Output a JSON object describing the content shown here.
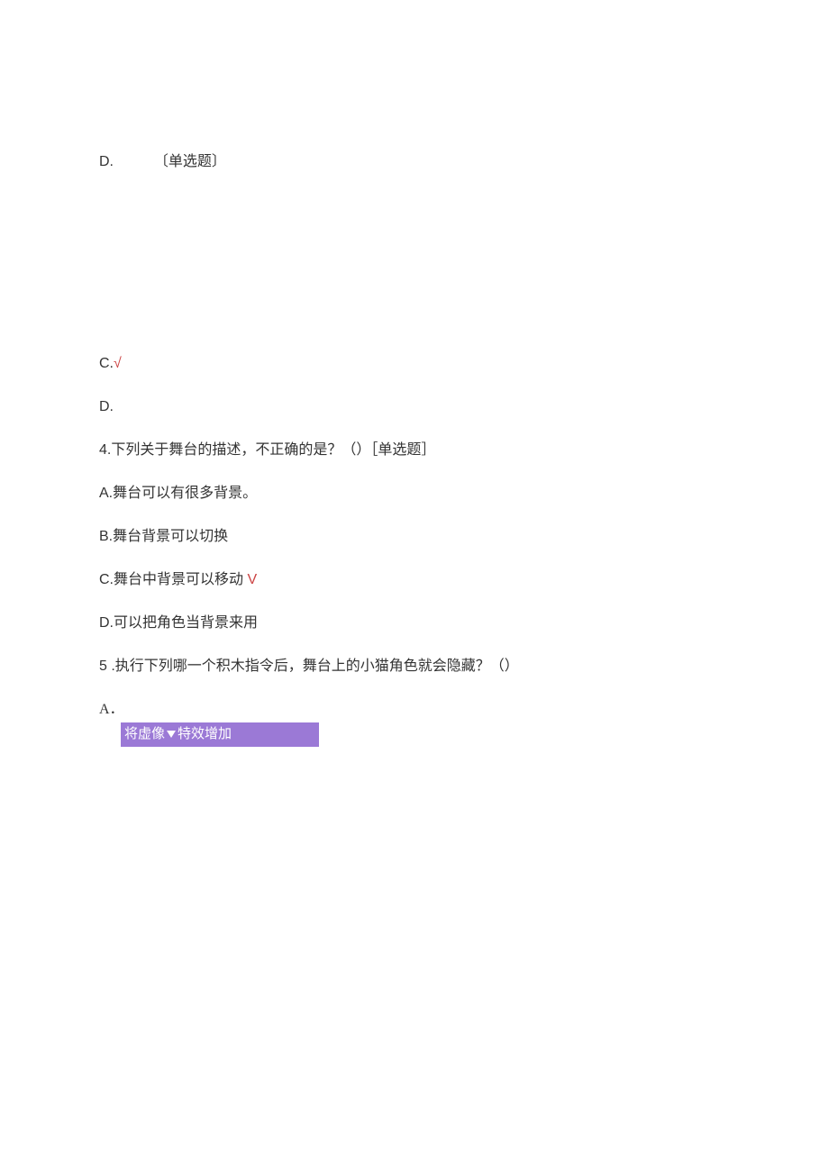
{
  "q_prev": {
    "option_d_label": "D.",
    "tag": "〔单选题〕"
  },
  "q3_tail": {
    "option_c_label": "C.",
    "option_c_mark": "√",
    "option_d_label": "D."
  },
  "q4": {
    "stem": "4.下列关于舞台的描述，不正确的是？（）［单选题］",
    "a": "A.舞台可以有很多背景。",
    "b": "B.舞台背景可以切换",
    "c_text": "C.舞台中背景可以移动",
    "c_mark": " V",
    "d": "D.可以把角色当背景来用"
  },
  "q5": {
    "stem": "5 .执行下列哪一个积木指令后，舞台上的小猫角色就会隐藏？（）",
    "option_a_label": "A．",
    "block_prefix": "将虚像",
    "block_suffix": "特效增加"
  }
}
